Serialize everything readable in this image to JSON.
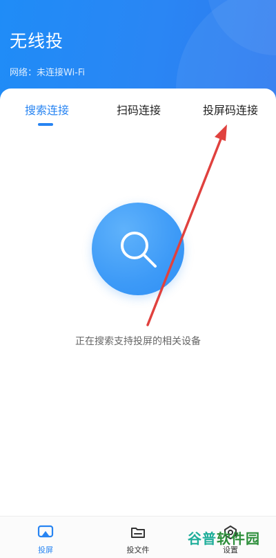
{
  "header": {
    "title": "无线投",
    "network_status": "网络：未连接Wi-Fi"
  },
  "tabs": [
    {
      "label": "搜索连接",
      "active": true
    },
    {
      "label": "扫码连接",
      "active": false
    },
    {
      "label": "投屏码连接",
      "active": false
    }
  ],
  "main": {
    "status_text": "正在搜索支持投屏的相关设备",
    "icon": "search-icon"
  },
  "bottom_nav": [
    {
      "label": "投屏",
      "icon": "cast-screen-icon",
      "active": true
    },
    {
      "label": "投文件",
      "icon": "folder-icon",
      "active": false
    },
    {
      "label": "设置",
      "icon": "settings-icon",
      "active": false
    }
  ],
  "watermark": {
    "part1": "谷普",
    "part2": "软件园"
  },
  "colors": {
    "accent": "#2784f2",
    "header_bg": "#1f8cf7",
    "annotation_arrow": "#e0413e"
  }
}
